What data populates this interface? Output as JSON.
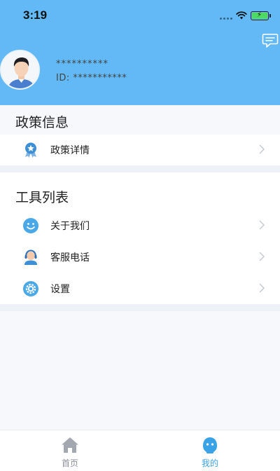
{
  "status_bar": {
    "time": "3:19"
  },
  "profile": {
    "username": "**********",
    "id_text": "ID: ***********"
  },
  "sections": [
    {
      "title": "政策信息",
      "items": [
        {
          "label": "政策详情",
          "icon": "award-badge-icon"
        }
      ]
    },
    {
      "title": "工具列表",
      "items": [
        {
          "label": "关于我们",
          "icon": "smiley-icon"
        },
        {
          "label": "客服电话",
          "icon": "customer-service-icon"
        },
        {
          "label": "设置",
          "icon": "settings-gear-icon"
        }
      ]
    }
  ],
  "tabbar": {
    "tabs": [
      {
        "label": "首页",
        "icon": "home-icon",
        "active": false
      },
      {
        "label": "我的",
        "icon": "profile-icon",
        "active": true
      }
    ]
  },
  "colors": {
    "header_bg": "#62b9f5",
    "accent": "#4aa8e8",
    "tab_inactive": "#8a8f99",
    "tab_active": "#3aa2e6"
  }
}
